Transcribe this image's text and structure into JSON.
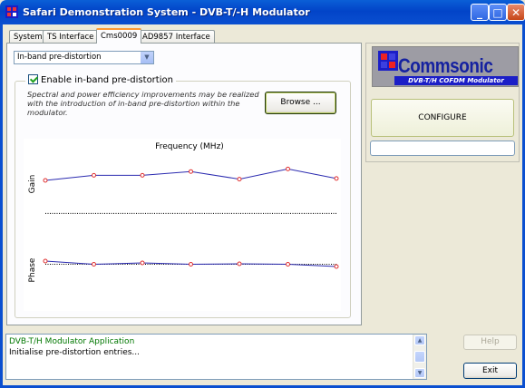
{
  "window": {
    "title": "Safari Demonstration System - DVB-T/-H Modulator",
    "minimize_label": "_",
    "maximize_label": "□",
    "close_label": "✕"
  },
  "tabs": [
    {
      "label": "System"
    },
    {
      "label": "TS Interface"
    },
    {
      "label": "Cms0009"
    },
    {
      "label": "AD9857 Interface"
    }
  ],
  "mode_select": {
    "value": "In-band pre-distortion"
  },
  "predistortion": {
    "checkbox_label": "Enable in-band pre-distortion",
    "checked": true,
    "description_lines": [
      "Spectral and power efficiency improvements may be realized",
      "with the introduction of in-band pre-distortion within the",
      "modulator."
    ],
    "browse_label": "Browse ..."
  },
  "chart_data": {
    "type": "line",
    "title": "Frequency (MHz)",
    "x": [
      1,
      2,
      3,
      4,
      5,
      6,
      7,
      8
    ],
    "panels": [
      {
        "ylabel": "Gain",
        "values": [
          0.0,
          0.4,
          0.4,
          0.7,
          0.1,
          0.9,
          0.15,
          null
        ],
        "points": [
          0.0,
          0.4,
          0.4,
          0.7,
          0.1,
          0.9,
          0.15
        ],
        "reference": -2.6
      },
      {
        "ylabel": "Phase",
        "points": [
          0.0,
          -0.35,
          -0.2,
          -0.35,
          -0.3,
          -0.35,
          -0.6
        ],
        "reference": -0.35
      }
    ],
    "line_color": "#2B2BB0",
    "marker_color": "#E03030"
  },
  "brand": {
    "name": "Commsonic",
    "subtitle": "DVB-T/H COFDM Modulator"
  },
  "configure_label": "CONFIGURE",
  "console": {
    "lines": [
      "DVB-T/H Modulator Application",
      "Initialise pre-distortion entries..."
    ]
  },
  "buttons": {
    "help_label": "Help",
    "exit_label": "Exit"
  }
}
